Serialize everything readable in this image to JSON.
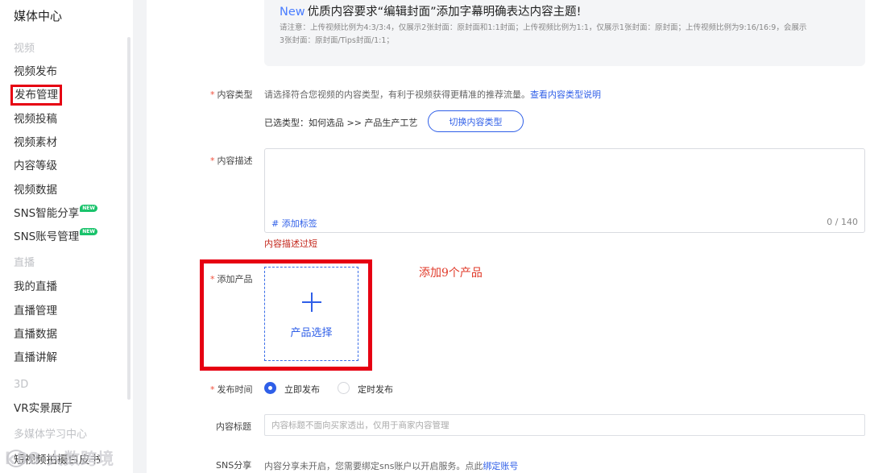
{
  "sidebar": {
    "brand": "媒体中心",
    "groups": {
      "video": "视频",
      "live": "直播",
      "three_d": "3D",
      "learning": "多媒体学习中心"
    },
    "items": {
      "video_publish": "视频发布",
      "publish_manage": "发布管理",
      "video_submit": "视频投稿",
      "video_material": "视频素材",
      "content_level": "内容等级",
      "video_data": "视频数据",
      "sns_share": "SNS智能分享",
      "sns_account": "SNS账号管理",
      "my_live": "我的直播",
      "live_manage": "直播管理",
      "live_data": "直播数据",
      "live_explain": "直播讲解",
      "vr_hall": "VR实景展厅",
      "short_video_partial": "短视频拍摄白皮书"
    },
    "new_badge": "NEW",
    "watermark": "k88 大数跨境"
  },
  "notice": {
    "new_tag": "New",
    "title": "优质内容要求“编辑封面”添加字幕明确表达内容主题!",
    "text": "请注意：上传视频比例为4:3/3:4，仅展示2张封面：原封面和1:1封面；上传视频比例为1:1，仅展示1张封面：原封面；上传视频比例为9:16/16:9，会展示3张封面：原封面/Tips封面/1:1；"
  },
  "content_type": {
    "label": "内容类型",
    "hint": "请选择符合您视频的内容类型，有利于视频获得更精准的推荐流量。",
    "hint_link": "查看内容类型说明",
    "selected": "已选类型：如何选品 >> 产品生产工艺",
    "switch_button": "切换内容类型"
  },
  "description": {
    "label": "内容描述",
    "add_tag": "# 添加标签",
    "counter": "0 / 140",
    "error": "内容描述过短"
  },
  "product": {
    "label": "添加产品",
    "picker_label": "产品选择",
    "annotation": "添加9个产品"
  },
  "publish_time": {
    "label": "发布时间",
    "options": [
      "立即发布",
      "定时发布"
    ],
    "selected": "立即发布"
  },
  "content_title": {
    "label": "内容标题",
    "placeholder": "内容标题不面向买家透出，仅用于商家内容管理"
  },
  "sns_share": {
    "label": "SNS分享",
    "text": "内容分享未开启，您需要绑定sns账户以开启服务。点此",
    "link": "绑定账号"
  },
  "colors": {
    "accent": "#2f5fe8",
    "annotation_red": "#e60012",
    "error": "#c3261a",
    "new_badge": "#19c36b"
  }
}
